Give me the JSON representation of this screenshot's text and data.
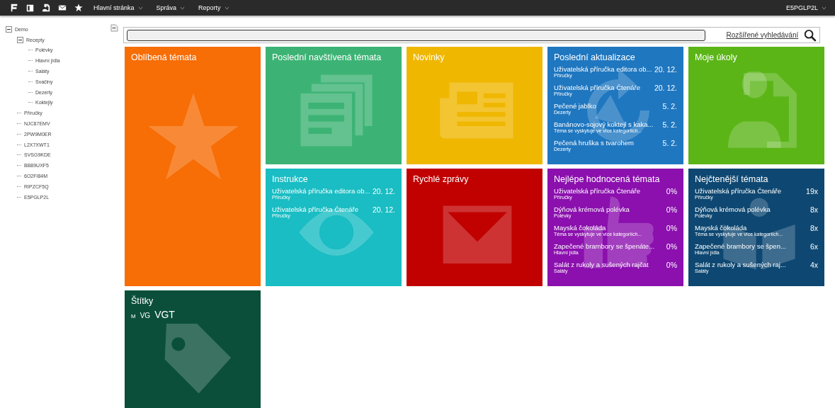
{
  "top_bar": {
    "menus": [
      {
        "label": "Hlavní stránka"
      },
      {
        "label": "Správa"
      },
      {
        "label": "Reporty"
      }
    ],
    "user": "E5PGLP2L"
  },
  "tree": [
    {
      "label": "Demo",
      "expanded": true,
      "children": [
        {
          "label": "Recepty",
          "expanded": true,
          "children": [
            {
              "label": "Polévky"
            },
            {
              "label": "Hlavní jídla"
            },
            {
              "label": "Saláty"
            },
            {
              "label": "Svačiny"
            },
            {
              "label": "Dezerty"
            },
            {
              "label": "Koktejly"
            }
          ]
        },
        {
          "label": "Příručky"
        },
        {
          "label": "NJC87EMV"
        },
        {
          "label": "2PW9M0ER"
        },
        {
          "label": "L2X7XWT1"
        },
        {
          "label": "SVSG9KDE"
        },
        {
          "label": "BB89UXF5"
        },
        {
          "label": "6O2FI84M"
        },
        {
          "label": "RIPZCF5Q"
        },
        {
          "label": "E5PGLP2L"
        }
      ]
    }
  ],
  "search": {
    "advanced_link": "Rozšířené vyhledávání"
  },
  "tiles": [
    {
      "kind": "plain",
      "title": "Oblíbená témata",
      "color": "#f76d06"
    },
    {
      "kind": "plain",
      "title": "Poslední navštívená témata",
      "color": "#3cb374"
    },
    {
      "kind": "plain",
      "title": "Novinky",
      "color": "#f0b700"
    },
    {
      "kind": "list",
      "title": "Poslední aktualizace",
      "color": "#1f77c0",
      "items": [
        {
          "title": "Uživatelská příručka editora ob...",
          "category": "Příručky",
          "value": "20. 12."
        },
        {
          "title": "Uživatelská příručka Čtenáře",
          "category": "Příručky",
          "value": "20. 12."
        },
        {
          "title": "Pečené jablko",
          "category": "Dezerty",
          "value": "5. 2."
        },
        {
          "title": "Banánovo-sojový koktejl s kaka...",
          "category": "Téma se vyskytuje ve více kategoriích...",
          "value": "5. 2."
        },
        {
          "title": "Pečená hruška s tvarohem",
          "category": "Dezerty",
          "value": "5. 2."
        }
      ]
    },
    {
      "kind": "plain",
      "title": "Moje úkoly",
      "color": "#5bb517"
    },
    {
      "kind": "list",
      "title": "Instrukce",
      "color": "#19bdc3",
      "items": [
        {
          "title": "Uživatelská příručka editora ob...",
          "category": "Příručky",
          "value": "20. 12."
        },
        {
          "title": "Uživatelská příručka Čtenáře",
          "category": "Příručky",
          "value": "20. 12."
        }
      ]
    },
    {
      "kind": "plain",
      "title": "Rychlé zprávy",
      "color": "#c10000"
    },
    {
      "kind": "list",
      "title": "Nejlépe hodnocená témata",
      "color": "#8b10ae",
      "items": [
        {
          "title": "Uživatelská příručka Čtenáře",
          "category": "Příručky",
          "value": "0%"
        },
        {
          "title": "Dýňová krémová polévka",
          "category": "Polévky",
          "value": "0%"
        },
        {
          "title": "Mayská čokoláda",
          "category": "Téma se vyskytuje ve více kategoriích...",
          "value": "0%"
        },
        {
          "title": "Zapečené brambory se špenáte...",
          "category": "Hlavní jídla",
          "value": "0%"
        },
        {
          "title": "Salát z rukoly a sušených rajčat",
          "category": "Saláty",
          "value": "0%"
        }
      ]
    },
    {
      "kind": "list",
      "title": "Nejčtenější témata",
      "color": "#0e4872",
      "items": [
        {
          "title": "Uživatelská příručka Čtenáře",
          "category": "Příručky",
          "value": "19x"
        },
        {
          "title": "Dýňová krémová polévka",
          "category": "Polévky",
          "value": "8x"
        },
        {
          "title": "Mayská čokoláda",
          "category": "Téma se vyskytuje ve více kategoriích...",
          "value": "8x"
        },
        {
          "title": "Zapečené brambory se špen...",
          "category": "Hlavní jídla",
          "value": "6x"
        },
        {
          "title": "Salát z rukoly a sušených raj...",
          "category": "Saláty",
          "value": "4x"
        }
      ]
    },
    {
      "kind": "tags",
      "title": "Štítky",
      "color": "#0b4f3b",
      "tags": [
        {
          "label": "M",
          "kind": "small"
        },
        {
          "label": "VG",
          "kind": "medium"
        },
        {
          "label": "VGT",
          "kind": "large"
        }
      ]
    }
  ]
}
